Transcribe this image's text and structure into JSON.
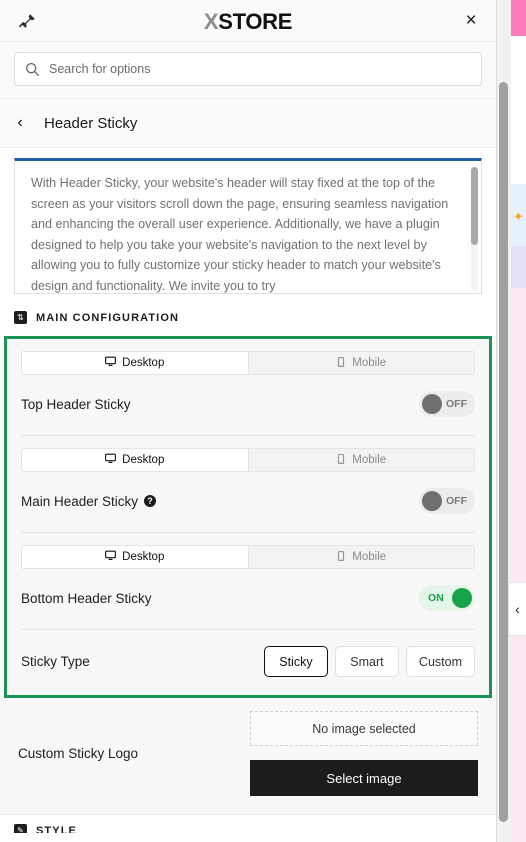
{
  "window": {
    "pin_icon": "pushpin-icon",
    "brand_x": "X",
    "brand_name": "STORE",
    "close_icon": "×"
  },
  "search": {
    "icon": "search-icon",
    "placeholder": "Search for options",
    "value": ""
  },
  "breadcrumb": {
    "back_icon": "‹",
    "title": "Header Sticky"
  },
  "description": {
    "text": "With Header Sticky, your website's header will stay fixed at the top of the screen as your visitors scroll down the page, ensuring seamless navigation and enhancing the overall user experience. Additionally, we have a plugin designed to help you take your website's navigation to the next level by allowing you to fully customize your sticky header to match your website's design and functionality. We invite you to try"
  },
  "main_configuration": {
    "icon": "configuration-icon",
    "label": "MAIN CONFIGURATION",
    "highlight_color": "#1a9455",
    "rows": [
      {
        "device_tabs": {
          "desktop": "Desktop",
          "mobile": "Mobile",
          "active": "Desktop"
        },
        "label": "Top Header Sticky",
        "toggle": {
          "state": "OFF",
          "label": "OFF"
        },
        "has_help": false
      },
      {
        "device_tabs": {
          "desktop": "Desktop",
          "mobile": "Mobile",
          "active": "Desktop"
        },
        "label": "Main Header Sticky",
        "toggle": {
          "state": "OFF",
          "label": "OFF"
        },
        "has_help": true,
        "help_icon": "?"
      },
      {
        "device_tabs": {
          "desktop": "Desktop",
          "mobile": "Mobile",
          "active": "Desktop"
        },
        "label": "Bottom Header Sticky",
        "toggle": {
          "state": "ON",
          "label": "ON"
        },
        "has_help": false
      }
    ],
    "sticky_type": {
      "label": "Sticky Type",
      "options": [
        "Sticky",
        "Smart",
        "Custom"
      ],
      "selected": "Sticky"
    }
  },
  "custom_sticky_logo": {
    "label": "Custom Sticky Logo",
    "no_image_text": "No image selected",
    "select_button": "Select image"
  },
  "style_section": {
    "icon": "style-icon",
    "label": "STYLE"
  },
  "page_background": {
    "collapse_icon": "‹",
    "sparkle_icon": "✦"
  }
}
